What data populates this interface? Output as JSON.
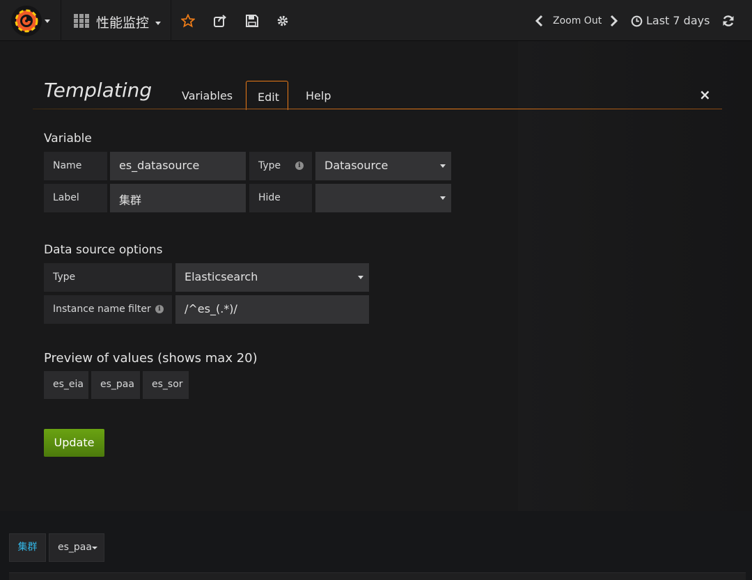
{
  "navbar": {
    "dashboard_title": "性能监控",
    "zoom_out_label": "Zoom Out",
    "time_range_label": "Last 7 days",
    "icons": [
      "grafana-logo-icon",
      "dashboard-grid-icon",
      "star-icon",
      "share-icon",
      "save-icon",
      "gear-icon",
      "chevron-left-icon",
      "chevron-right-icon",
      "clock-icon",
      "refresh-icon"
    ],
    "colors": {
      "star": "#eb7b18",
      "logo": "#f05a28"
    }
  },
  "templating": {
    "title": "Templating",
    "tabs": [
      {
        "label": "Variables",
        "active": false
      },
      {
        "label": "Edit",
        "active": true
      },
      {
        "label": "Help",
        "active": false
      }
    ],
    "close_icon": "×",
    "accent_color": "#eb7b18"
  },
  "variable": {
    "section_title": "Variable",
    "name_label": "Name",
    "name_value": "es_datasource",
    "type_label": "Type",
    "type_value": "Datasource",
    "label_label": "Label",
    "label_value": "集群",
    "hide_label": "Hide",
    "hide_value": ""
  },
  "datasource_options": {
    "section_title": "Data source options",
    "type_label": "Type",
    "type_value": "Elasticsearch",
    "filter_label": "Instance name filter",
    "filter_value": "/^es_(.*)/"
  },
  "preview": {
    "section_title": "Preview of values (shows max 20)",
    "values": [
      "es_eia",
      "es_paa",
      "es_sor"
    ]
  },
  "update_button": {
    "label": "Update",
    "color": "#5a8c0f"
  },
  "submenu": {
    "variable_label": "集群",
    "variable_value": "es_paa",
    "label_color": "#33b5e5"
  }
}
